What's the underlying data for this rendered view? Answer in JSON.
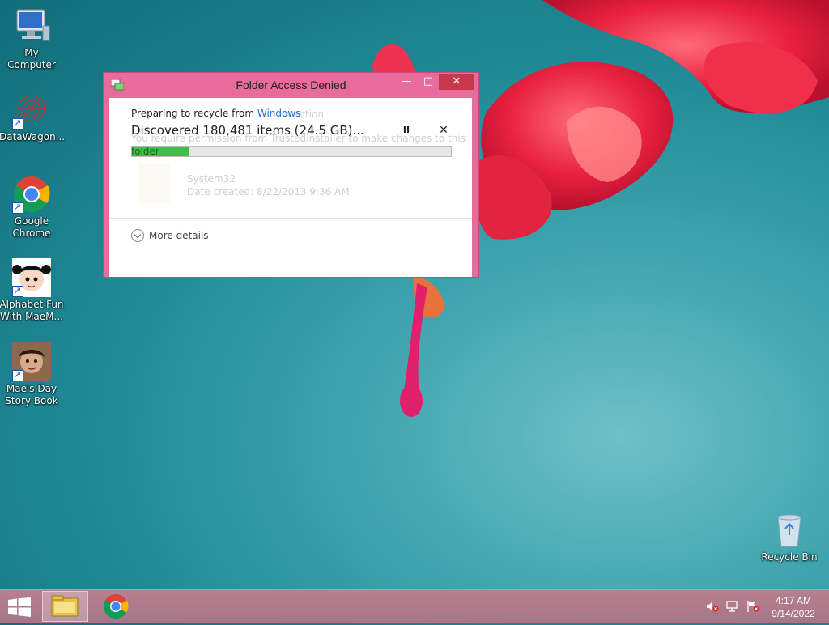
{
  "desktop": {
    "icons": [
      {
        "label": "My Computer",
        "icon": "computer-icon"
      },
      {
        "label": "DataWagon...",
        "icon": "datawagon-icon"
      },
      {
        "label": "Google Chrome",
        "icon": "chrome-icon"
      },
      {
        "label": "Alphabet Fun With MaeM...",
        "icon": "alphabet-fun-icon"
      },
      {
        "label": "Mae's Day Story Book",
        "icon": "story-book-icon"
      },
      {
        "label": "Recycle Bin",
        "icon": "recycle-bin-icon"
      }
    ]
  },
  "dialog": {
    "title": "Folder Access Denied",
    "preparing_prefix": "Preparing to recycle from ",
    "preparing_location": "Windows",
    "discovered": "Discovered 180,481 items (24.5 GB)...",
    "progress_percent": 18,
    "more_details": "More details",
    "background": {
      "action_text": "s action",
      "permission_text": "You require permission from TrustedInstaller to make changes to this",
      "folder_word": "folder",
      "item_name": "System32",
      "item_date": "Date created: 8/22/2013 9:36 AM"
    },
    "minimize_glyph": "—",
    "maximize_glyph": "□",
    "close_glyph": "✕",
    "pause_glyph": "II",
    "stop_glyph": "✕"
  },
  "taskbar": {
    "time": "4:17 AM",
    "date": "9/14/2022"
  },
  "colors": {
    "dialog_frame": "#e76c9b",
    "close_button": "#c7384d",
    "progress_fill": "#3fbf4a",
    "taskbar": "#b07a8c"
  }
}
